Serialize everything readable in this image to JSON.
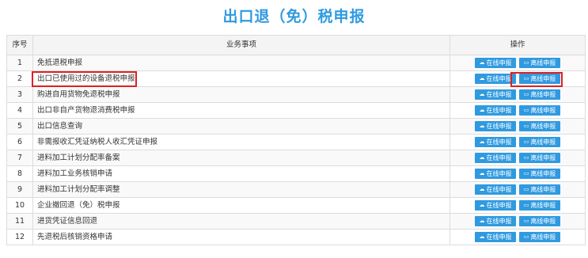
{
  "title": "出口退（免）税申报",
  "table": {
    "headers": {
      "index": "序号",
      "item": "业务事项",
      "ops": "操作"
    },
    "online_label": "在线申报",
    "offline_label": "离线申报",
    "rows": [
      {
        "index": "1",
        "item": "免抵退税申报"
      },
      {
        "index": "2",
        "item": "出口已使用过的设备退税申报"
      },
      {
        "index": "3",
        "item": "购进自用货物免退税申报"
      },
      {
        "index": "4",
        "item": "出口非自产货物退消费税申报"
      },
      {
        "index": "5",
        "item": "出口信息查询"
      },
      {
        "index": "6",
        "item": "非需报收汇凭证纳税人收汇凭证申报"
      },
      {
        "index": "7",
        "item": "进料加工计划分配率备案"
      },
      {
        "index": "8",
        "item": "进料加工业务核销申请"
      },
      {
        "index": "9",
        "item": "进料加工计划分配率调整"
      },
      {
        "index": "10",
        "item": "企业撤回退（免）税申报"
      },
      {
        "index": "11",
        "item": "进货凭证信息回退"
      },
      {
        "index": "12",
        "item": "先退税后核销资格申请"
      }
    ]
  },
  "colors": {
    "accent": "#2f9ae0",
    "highlight": "#e02020"
  },
  "icons": {
    "online": "cloud-upload-icon",
    "offline": "monitor-icon"
  }
}
